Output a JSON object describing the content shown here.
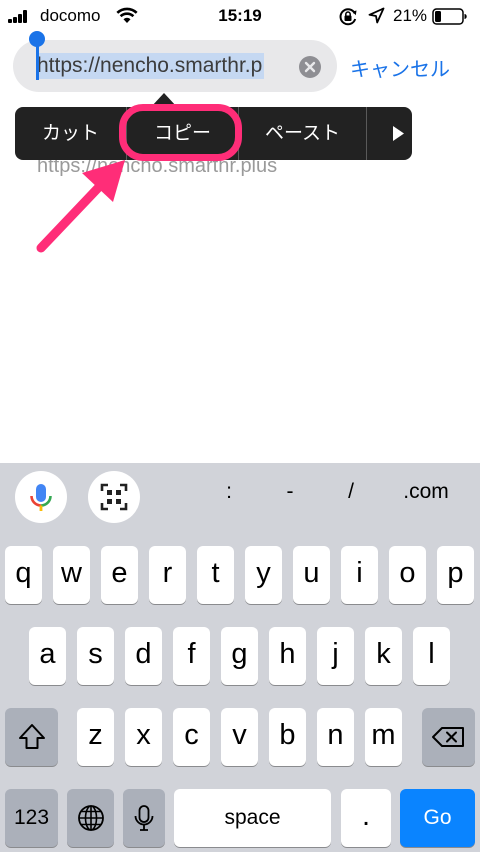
{
  "status_bar": {
    "carrier": "docomo",
    "time": "15:19",
    "battery_percent": "21%"
  },
  "url_bar": {
    "url_text": "https://nencho.smarthr.p",
    "cancel_label": "キャンセル"
  },
  "suggestion": {
    "text": "https://nencho.smarthr.plus"
  },
  "edit_menu": {
    "items": [
      "カット",
      "コピー",
      "ペースト"
    ],
    "highlighted_item": "コピー"
  },
  "keyboard": {
    "accessory_symbols": [
      ":",
      "-",
      "/",
      ".com"
    ],
    "row1": [
      "q",
      "w",
      "e",
      "r",
      "t",
      "y",
      "u",
      "i",
      "o",
      "p"
    ],
    "row2": [
      "a",
      "s",
      "d",
      "f",
      "g",
      "h",
      "j",
      "k",
      "l"
    ],
    "row3": [
      "z",
      "x",
      "c",
      "v",
      "b",
      "n",
      "m"
    ],
    "numbers_label": "123",
    "space_label": "space",
    "period_label": ".",
    "go_label": "Go"
  },
  "colors": {
    "accent_blue": "#1a73e8",
    "highlight_pink": "#ff2d78",
    "go_blue": "#0a84ff"
  }
}
